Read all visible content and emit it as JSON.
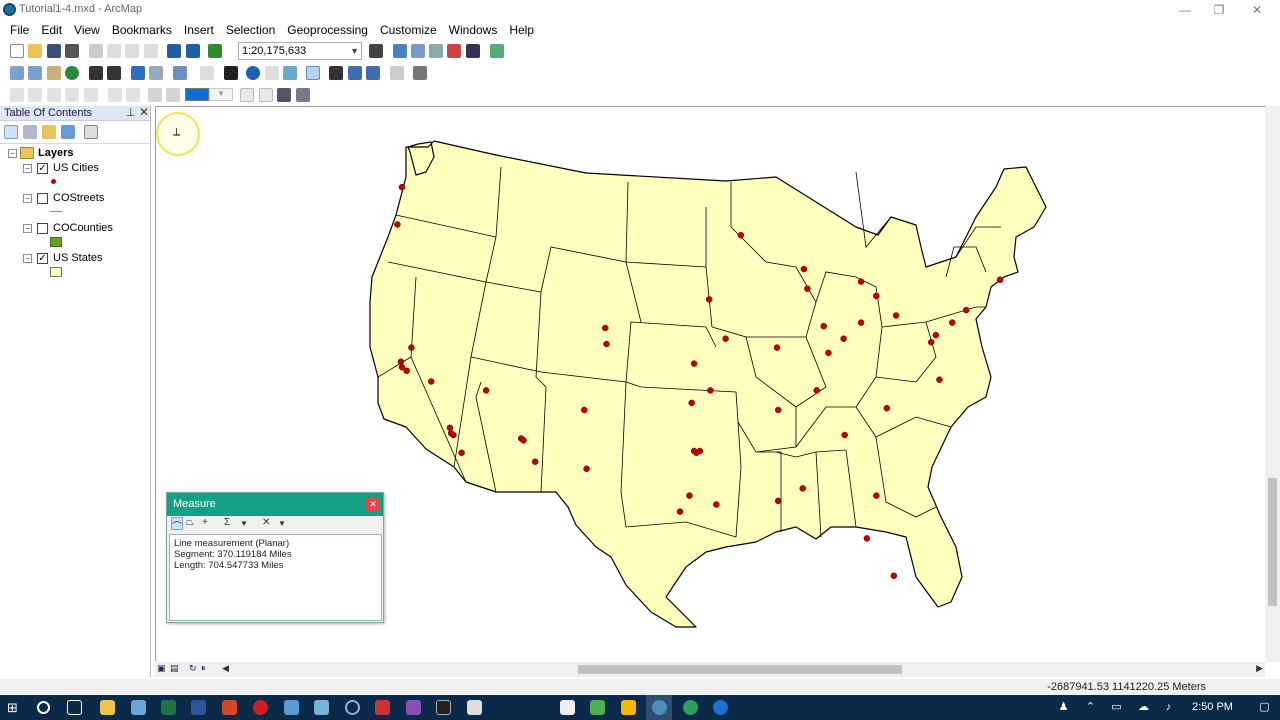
{
  "window": {
    "title": "Tutorial1-4.mxd - ArcMap",
    "minimize": "—",
    "restore": "❐",
    "close": "✕"
  },
  "menu": [
    "File",
    "Edit",
    "View",
    "Bookmarks",
    "Insert",
    "Selection",
    "Geoprocessing",
    "Customize",
    "Windows",
    "Help"
  ],
  "toolbar": {
    "scale": "1:20,175,633"
  },
  "toc": {
    "title": "Table Of Contents",
    "root": "Layers",
    "layers": [
      {
        "name": "US Cities",
        "checked": true,
        "symbol": "point"
      },
      {
        "name": "COStreets",
        "checked": false,
        "symbol": "line"
      },
      {
        "name": "COCounties",
        "checked": false,
        "symbol": "fill-green"
      },
      {
        "name": "US States",
        "checked": true,
        "symbol": "fill-yellow"
      }
    ]
  },
  "map": {
    "state_fill": "#ffffbe",
    "city_color": "#c00000",
    "cities": [
      [
        -122.3,
        47.6
      ],
      [
        -122.7,
        45.5
      ],
      [
        -122.4,
        37.8
      ],
      [
        -122.3,
        37.5
      ],
      [
        -121.9,
        37.3
      ],
      [
        -121.5,
        38.6
      ],
      [
        -119.8,
        36.7
      ],
      [
        -118.2,
        34.1
      ],
      [
        -118.1,
        33.8
      ],
      [
        -117.9,
        33.7
      ],
      [
        -117.2,
        32.7
      ],
      [
        -115.1,
        36.2
      ],
      [
        -112.1,
        33.5
      ],
      [
        -111.9,
        33.4
      ],
      [
        -110.9,
        32.2
      ],
      [
        -106.7,
        35.1
      ],
      [
        -106.5,
        31.8
      ],
      [
        -104.9,
        39.7
      ],
      [
        -104.8,
        38.8
      ],
      [
        -97.3,
        37.7
      ],
      [
        -97.5,
        35.5
      ],
      [
        -95.9,
        36.2
      ],
      [
        -96.8,
        32.8
      ],
      [
        -97.1,
        32.7
      ],
      [
        -97.3,
        32.8
      ],
      [
        -97.7,
        30.3
      ],
      [
        -98.5,
        29.4
      ],
      [
        -95.4,
        29.8
      ],
      [
        -96.0,
        41.3
      ],
      [
        -94.6,
        39.1
      ],
      [
        -93.3,
        44.9
      ],
      [
        -90.2,
        38.6
      ],
      [
        -90.1,
        35.1
      ],
      [
        -90.1,
        30.0
      ],
      [
        -87.6,
        41.9
      ],
      [
        -87.9,
        43.0
      ],
      [
        -86.2,
        39.8
      ],
      [
        -86.8,
        36.2
      ],
      [
        -84.4,
        33.7
      ],
      [
        -84.5,
        39.1
      ],
      [
        -83.0,
        40.0
      ],
      [
        -81.7,
        41.5
      ],
      [
        -83.0,
        42.3
      ],
      [
        -85.8,
        38.3
      ],
      [
        -80.0,
        40.4
      ],
      [
        -80.8,
        35.2
      ],
      [
        -81.7,
        30.3
      ],
      [
        -82.5,
        27.9
      ],
      [
        -80.2,
        25.8
      ],
      [
        -76.6,
        39.3
      ],
      [
        -77.0,
        38.9
      ],
      [
        -75.2,
        40.0
      ],
      [
        -74.0,
        40.7
      ],
      [
        -71.1,
        42.4
      ],
      [
        -76.3,
        36.8
      ],
      [
        -88.0,
        30.7
      ]
    ]
  },
  "measure": {
    "title": "Measure",
    "lines": [
      "Line measurement (Planar)",
      "Segment: 370.119184 Miles",
      "Length: 704.547733 Miles"
    ]
  },
  "status": {
    "coords": "-2687941.53  1141220.25 Meters"
  },
  "taskbar": {
    "time": "2:50 PM"
  }
}
